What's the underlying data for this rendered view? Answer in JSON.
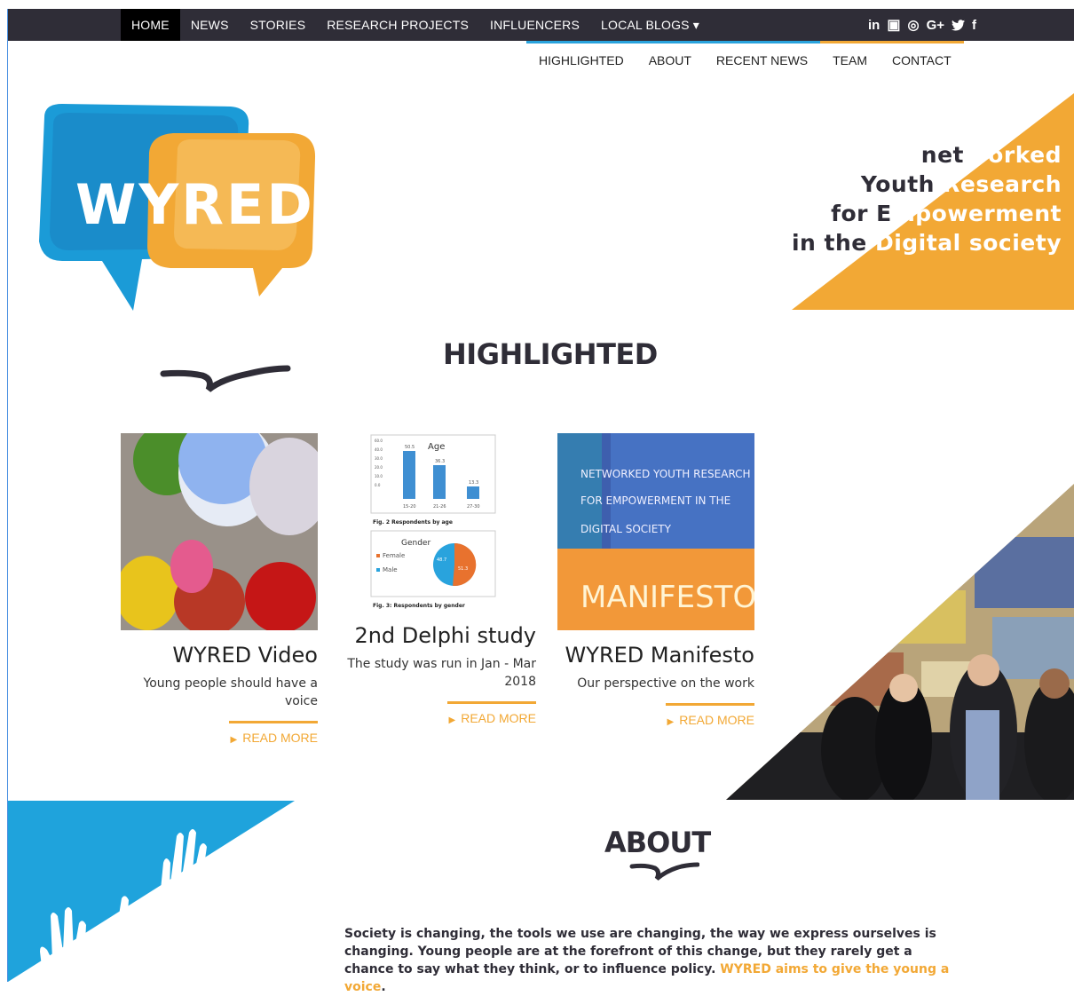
{
  "topnav": {
    "items": [
      {
        "label": "HOME",
        "active": true
      },
      {
        "label": "NEWS"
      },
      {
        "label": "STORIES"
      },
      {
        "label": "RESEARCH PROJECTS"
      },
      {
        "label": "INFLUENCERS"
      },
      {
        "label": "LOCAL BLOGS ▾"
      }
    ],
    "social": [
      "linkedin-icon",
      "youtube-icon",
      "instagram-icon",
      "google-plus-icon",
      "twitter-icon",
      "facebook-icon"
    ],
    "social_glyphs": {
      "linkedin": "in",
      "youtube": "▣",
      "instagram": "◎",
      "gplus": "G+",
      "twitter": "🐦",
      "facebook": "f"
    }
  },
  "subnav": {
    "items": [
      {
        "label": "HIGHLIGHTED",
        "color": "#29a3dd"
      },
      {
        "label": "ABOUT",
        "color": "#29a3dd"
      },
      {
        "label": "RECENT NEWS",
        "color": "#29a3dd"
      },
      {
        "label": "TEAM",
        "color": "#f2a835"
      },
      {
        "label": "CONTACT",
        "color": "#f2a835"
      }
    ]
  },
  "logo": {
    "text": "WYRED"
  },
  "tagline": {
    "l1a": "net",
    "l1b": "Worked",
    "l2a": "Youth",
    "l2b": " Research",
    "l3a": "for E",
    "l3b": "mpowerment",
    "l4a": "in the",
    "l4b": " Digital society"
  },
  "highlighted": {
    "title": "HIGHLIGHTED",
    "cards": [
      {
        "title": "WYRED Video",
        "desc": "Young people should have a voice",
        "read_more": "READ MORE"
      },
      {
        "title": "2nd Delphi study",
        "desc": "The study was run in Jan - Mar 2018",
        "read_more": "READ MORE"
      },
      {
        "title": "WYRED Manifesto",
        "desc": "Our perspective on the work",
        "read_more": "READ MORE"
      }
    ]
  },
  "delphi_figure": {
    "age_title": "Age",
    "age_values": [
      "50.5",
      "36.3",
      "13.3"
    ],
    "age_labels": [
      "15-20",
      "21-26",
      "27-30"
    ],
    "age_axis": [
      "60.0",
      "50.0",
      "40.0",
      "30.0",
      "20.0",
      "10.0",
      "0.0"
    ],
    "fig2": "Fig. 2 Respondents by age",
    "gender_title": "Gender",
    "gender_legend": [
      "Female",
      "Male"
    ],
    "gender_values": [
      "48.7",
      "51.3"
    ],
    "fig3": "Fig. 3: Respondents by gender"
  },
  "manifesto_image": {
    "l1": "NETWORKED YOUTH RESEARCH",
    "l2": "FOR EMPOWERMENT IN THE",
    "l3": "DIGITAL SOCIETY",
    "l4": "MANIFESTO"
  },
  "about": {
    "title": "ABOUT",
    "text": "Society is changing, the tools we use are changing, the way we express ourselves is changing. Young people are at the forefront of this change, but they rarely get a chance to say what they think, or to influence policy. ",
    "highlight": "WYRED aims to give the young a voice",
    "end": "."
  },
  "colors": {
    "dark": "#2f2d37",
    "orange": "#f2a835",
    "blue": "#29a3dd"
  }
}
